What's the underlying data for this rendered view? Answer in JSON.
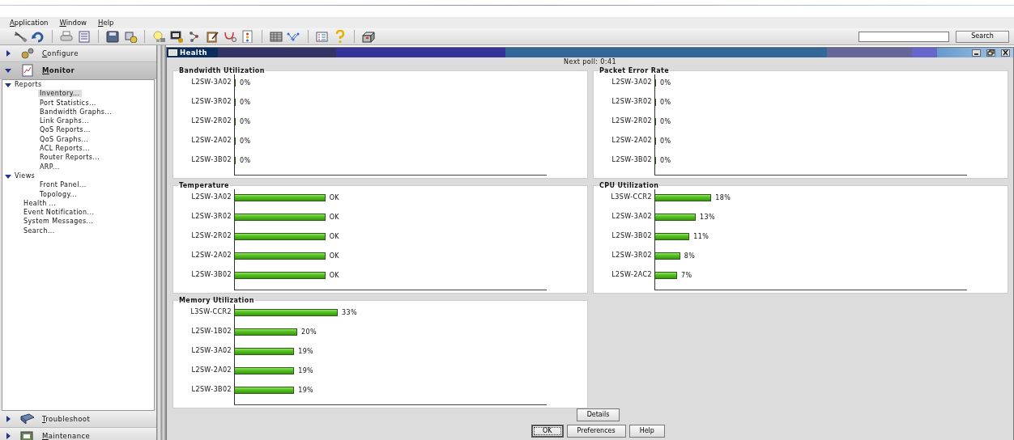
{
  "menu": [
    {
      "label": "Application"
    },
    {
      "label": "Window"
    },
    {
      "label": "Help"
    }
  ],
  "search": {
    "button": "Search"
  },
  "sidebar": {
    "sections": [
      {
        "label": "Configure",
        "expanded": false
      },
      {
        "label": "Monitor",
        "expanded": true
      },
      {
        "label": "Troubleshoot",
        "expanded": false
      },
      {
        "label": "Maintenance",
        "expanded": false
      }
    ],
    "tree": [
      {
        "label": "Reports",
        "expanded": true,
        "children": [
          {
            "label": "Inventory...",
            "selected": true
          },
          {
            "label": "Port Statistics...",
            "selected": false
          },
          {
            "label": "Bandwidth Graphs...",
            "selected": false
          },
          {
            "label": "Link Graphs...",
            "selected": false
          },
          {
            "label": "QoS Reports...",
            "selected": false
          },
          {
            "label": "QoS Graphs...",
            "selected": false
          },
          {
            "label": "ACL Reports...",
            "selected": false
          },
          {
            "label": "Router Reports...",
            "selected": false
          },
          {
            "label": "ARP...",
            "selected": false
          }
        ]
      },
      {
        "label": "Views",
        "expanded": true,
        "children": [
          {
            "label": "Front Panel...",
            "selected": false
          },
          {
            "label": "Topology...",
            "selected": false
          }
        ]
      },
      {
        "label": "Health ..."
      },
      {
        "label": "Event Notification..."
      },
      {
        "label": "System Messages..."
      },
      {
        "label": "Search..."
      }
    ]
  },
  "window": {
    "title": "Health"
  },
  "next_poll": "Next poll: 0:41",
  "panels": [
    {
      "title": "Bandwidth Utilization",
      "rows": [
        {
          "name": "L2SW-3A02",
          "level": 0,
          "reading": "0%"
        },
        {
          "name": "L2SW-3R02",
          "level": 0,
          "reading": "0%"
        },
        {
          "name": "L2SW-2R02",
          "level": 0,
          "reading": "0%"
        },
        {
          "name": "L2SW-2A02",
          "level": 0,
          "reading": "0%"
        },
        {
          "name": "L2SW-3B02",
          "level": 0,
          "reading": "0%"
        }
      ]
    },
    {
      "title": "Packet Error Rate",
      "rows": [
        {
          "name": "L2SW-3A02",
          "level": 0,
          "reading": "0%"
        },
        {
          "name": "L2SW-3R02",
          "level": 0,
          "reading": "0%"
        },
        {
          "name": "L2SW-2R02",
          "level": 0,
          "reading": "0%"
        },
        {
          "name": "L2SW-2A02",
          "level": 0,
          "reading": "0%"
        },
        {
          "name": "L2SW-3B02",
          "level": 0,
          "reading": "0%"
        }
      ]
    },
    {
      "title": "Temperature",
      "rows": [
        {
          "name": "L2SW-3A02",
          "level": 0.29,
          "reading": "OK"
        },
        {
          "name": "L2SW-3R02",
          "level": 0.29,
          "reading": "OK"
        },
        {
          "name": "L2SW-2R02",
          "level": 0.29,
          "reading": "OK"
        },
        {
          "name": "L2SW-2A02",
          "level": 0.29,
          "reading": "OK"
        },
        {
          "name": "L2SW-3B02",
          "level": 0.29,
          "reading": "OK"
        }
      ]
    },
    {
      "title": "CPU Utilization",
      "rows": [
        {
          "name": "L3SW-CCR2",
          "level": 0.18,
          "reading": "18%"
        },
        {
          "name": "L2SW-3A02",
          "level": 0.13,
          "reading": "13%"
        },
        {
          "name": "L2SW-3B02",
          "level": 0.11,
          "reading": "11%"
        },
        {
          "name": "L2SW-3R02",
          "level": 0.08,
          "reading": "8%"
        },
        {
          "name": "L2SW-2AC2",
          "level": 0.07,
          "reading": "7%"
        }
      ]
    },
    {
      "title": "Memory Utilization",
      "rows": [
        {
          "name": "L3SW-CCR2",
          "level": 0.33,
          "reading": "33%"
        },
        {
          "name": "L2SW-1B02",
          "level": 0.2,
          "reading": "20%"
        },
        {
          "name": "L2SW-3A02",
          "level": 0.19,
          "reading": "19%"
        },
        {
          "name": "L2SW-2A02",
          "level": 0.19,
          "reading": "19%"
        },
        {
          "name": "L2SW-3B02",
          "level": 0.19,
          "reading": "19%"
        }
      ]
    }
  ],
  "details_button": "Details",
  "dialog_buttons": [
    {
      "label": "OK",
      "default": true
    },
    {
      "label": "Preferences",
      "default": false
    },
    {
      "label": "Help",
      "default": false
    }
  ]
}
